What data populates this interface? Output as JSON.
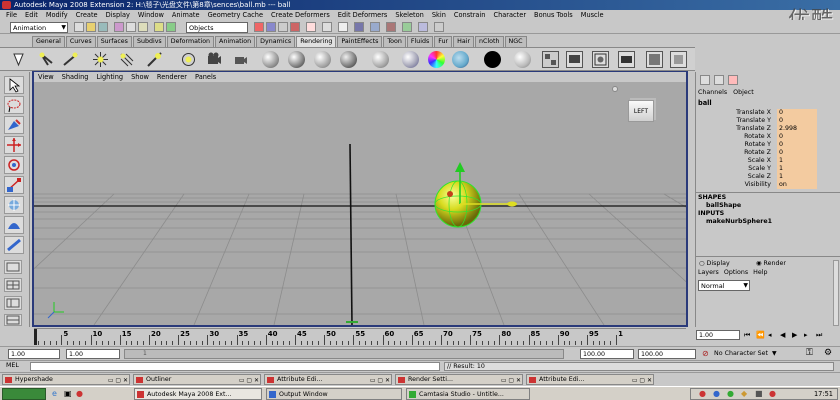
{
  "window": {
    "title": "Autodesk Maya 2008 Extension 2: H:\\毯子\\光盘文件\\第8章\\sences\\ball.mb  ---  ball",
    "watermark": "优酷"
  },
  "menubar": [
    "File",
    "Edit",
    "Modify",
    "Create",
    "Display",
    "Window",
    "Animate",
    "Geometry Cache",
    "Create Deformers",
    "Edit Deformers",
    "Skeleton",
    "Skin",
    "Constrain",
    "Character",
    "Bonus Tools",
    "Muscle"
  ],
  "statusline": {
    "mode": "Animation",
    "selection_field": "Objects"
  },
  "shelf_tabs": [
    "General",
    "Curves",
    "Surfaces",
    "Subdivs",
    "Deformation",
    "Animation",
    "Dynamics",
    "Rendering",
    "PaintEffects",
    "Toon",
    "Fluids",
    "Fur",
    "Hair",
    "nCloth",
    "NGC"
  ],
  "shelf_active_tab": "Rendering",
  "panel_menu": [
    "View",
    "Shading",
    "Lighting",
    "Show",
    "Renderer",
    "Panels"
  ],
  "viewport": {
    "view_cube_label": "LEFT",
    "object": "ball"
  },
  "channel_box": {
    "header_tabs": [
      "Channels",
      "Object"
    ],
    "object_name": "ball",
    "channels": [
      {
        "name": "Translate X",
        "value": "0"
      },
      {
        "name": "Translate Y",
        "value": "0"
      },
      {
        "name": "Translate Z",
        "value": "2.998"
      },
      {
        "name": "Rotate X",
        "value": "0"
      },
      {
        "name": "Rotate Y",
        "value": "0"
      },
      {
        "name": "Rotate Z",
        "value": "0"
      },
      {
        "name": "Scale X",
        "value": "1"
      },
      {
        "name": "Scale Y",
        "value": "1"
      },
      {
        "name": "Scale Z",
        "value": "1"
      },
      {
        "name": "Visibility",
        "value": "on"
      }
    ],
    "shapes_header": "SHAPES",
    "shape_name": "ballShape",
    "inputs_header": "INPUTS",
    "input_name": "makeNurbSphere1"
  },
  "layer_editor": {
    "display_label": "Display",
    "render_label": "Render",
    "menus": [
      "Layers",
      "Options",
      "Help"
    ],
    "mode_value": "Normal"
  },
  "timeline": {
    "ticks": [
      "5",
      "10",
      "15",
      "20",
      "25",
      "30",
      "35",
      "40",
      "45",
      "50",
      "55",
      "60",
      "65",
      "70",
      "75",
      "80",
      "85",
      "90",
      "95",
      "1"
    ],
    "current_frame": "1.00"
  },
  "range_slider": {
    "start_time": "1.00",
    "playback_start": "1.00",
    "range_mark": "1",
    "playback_end": "100.00",
    "end_time": "100.00",
    "character_set": "No Character Set"
  },
  "command_line": {
    "label": "MEL",
    "result": "// Result: 10"
  },
  "minimized_windows": [
    "Hypershade",
    "Outliner",
    "Attribute Edi...",
    "Render Setti...",
    "Attribute Edi..."
  ],
  "taskbar": {
    "tasks": [
      "Autodesk Maya 2008 Ext...",
      "Output Window",
      "Camtasia Studio - Untitle..."
    ],
    "clock": "17:51"
  }
}
